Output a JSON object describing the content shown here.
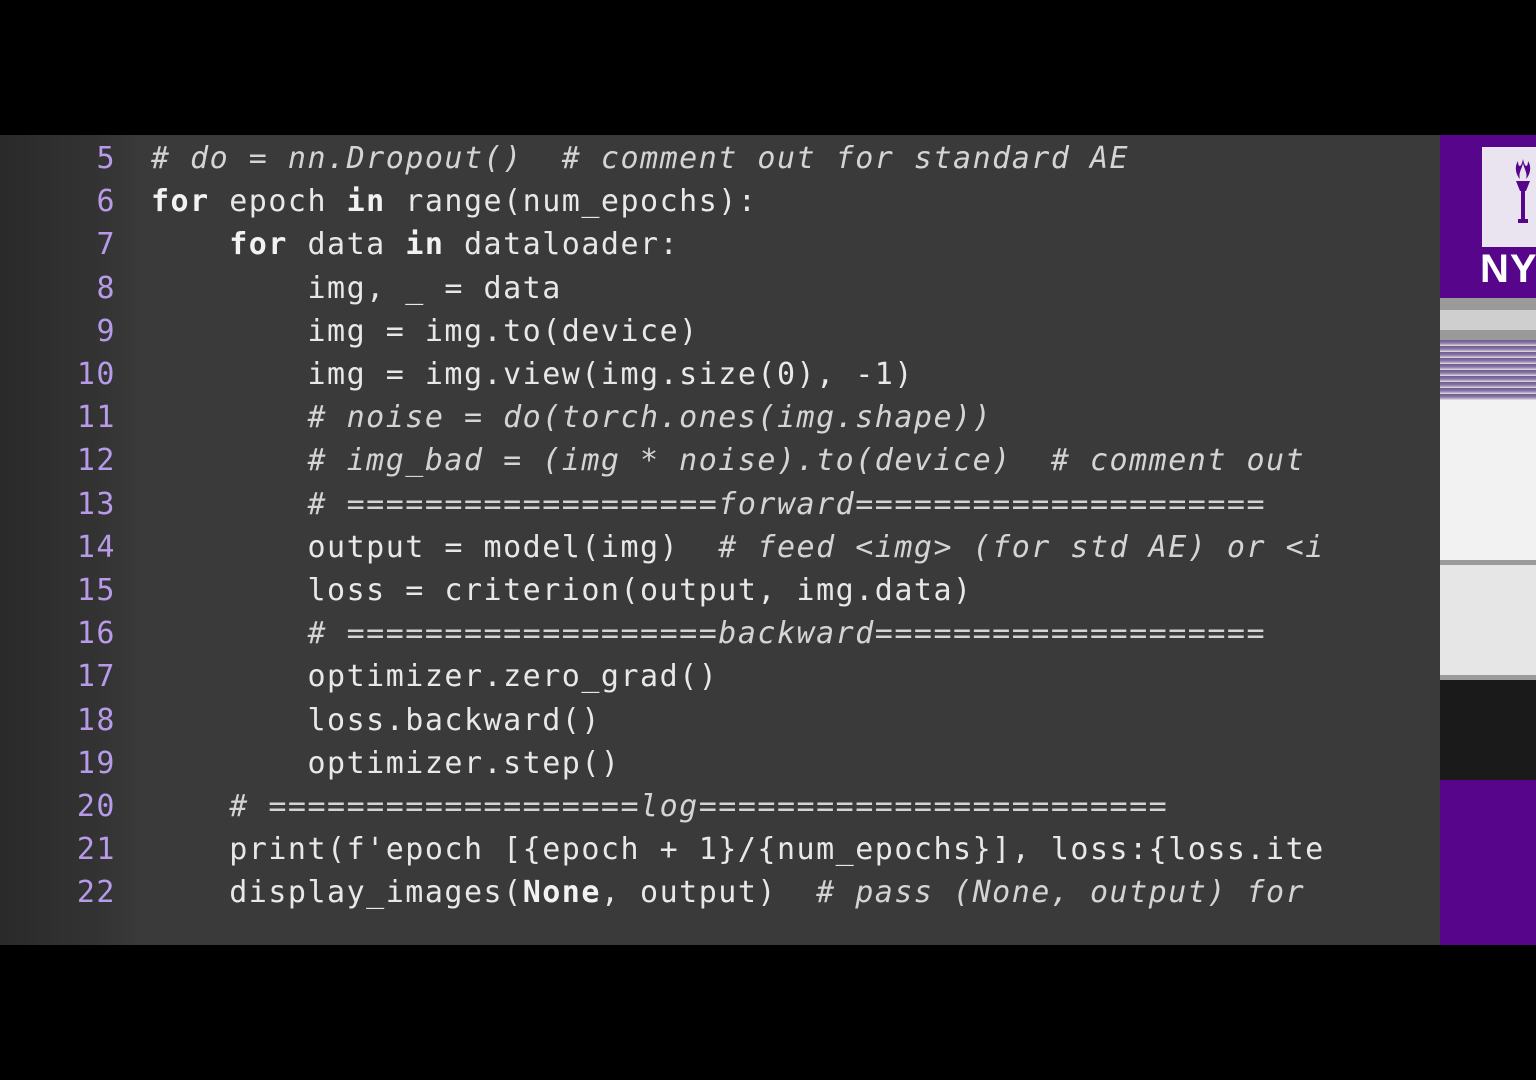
{
  "editor": {
    "lines": [
      {
        "num": "5",
        "indent": "",
        "parts": [
          {
            "t": "cm",
            "v": "# do = nn.Dropout()  # comment out for standard AE"
          }
        ]
      },
      {
        "num": "6",
        "indent": "",
        "parts": [
          {
            "t": "kw",
            "v": "for"
          },
          {
            "t": "tx",
            "v": " epoch "
          },
          {
            "t": "kw",
            "v": "in"
          },
          {
            "t": "tx",
            "v": " range(num_epochs):"
          }
        ]
      },
      {
        "num": "7",
        "indent": "    ",
        "parts": [
          {
            "t": "kw",
            "v": "for"
          },
          {
            "t": "tx",
            "v": " data "
          },
          {
            "t": "kw",
            "v": "in"
          },
          {
            "t": "tx",
            "v": " dataloader:"
          }
        ]
      },
      {
        "num": "8",
        "indent": "        ",
        "parts": [
          {
            "t": "tx",
            "v": "img, _ = data"
          }
        ]
      },
      {
        "num": "9",
        "indent": "        ",
        "parts": [
          {
            "t": "tx",
            "v": "img = img.to(device)"
          }
        ]
      },
      {
        "num": "10",
        "indent": "        ",
        "parts": [
          {
            "t": "tx",
            "v": "img = img.view(img.size(0), -1)"
          }
        ]
      },
      {
        "num": "11",
        "indent": "        ",
        "parts": [
          {
            "t": "cm",
            "v": "# noise = do(torch.ones(img.shape))"
          }
        ]
      },
      {
        "num": "12",
        "indent": "        ",
        "parts": [
          {
            "t": "cm",
            "v": "# img_bad = (img * noise).to(device)  # comment out"
          }
        ]
      },
      {
        "num": "13",
        "indent": "        ",
        "parts": [
          {
            "t": "cm",
            "v": "# ===================forward====================="
          }
        ]
      },
      {
        "num": "14",
        "indent": "        ",
        "parts": [
          {
            "t": "tx",
            "v": "output = model(img)  "
          },
          {
            "t": "cm",
            "v": "# feed <img> (for std AE) or <i"
          }
        ]
      },
      {
        "num": "15",
        "indent": "        ",
        "parts": [
          {
            "t": "tx",
            "v": "loss = criterion(output, img.data)"
          }
        ]
      },
      {
        "num": "16",
        "indent": "        ",
        "parts": [
          {
            "t": "cm",
            "v": "# ===================backward===================="
          }
        ]
      },
      {
        "num": "17",
        "indent": "        ",
        "parts": [
          {
            "t": "tx",
            "v": "optimizer.zero_grad()"
          }
        ]
      },
      {
        "num": "18",
        "indent": "        ",
        "parts": [
          {
            "t": "tx",
            "v": "loss.backward()"
          }
        ]
      },
      {
        "num": "19",
        "indent": "        ",
        "parts": [
          {
            "t": "tx",
            "v": "optimizer.step()"
          }
        ]
      },
      {
        "num": "20",
        "indent": "    ",
        "parts": [
          {
            "t": "cm",
            "v": "# ===================log========================"
          }
        ]
      },
      {
        "num": "21",
        "indent": "    ",
        "parts": [
          {
            "t": "tx",
            "v": "print(f'epoch [{epoch + 1}/{num_epochs}], loss:{loss.ite"
          }
        ]
      },
      {
        "num": "22",
        "indent": "    ",
        "parts": [
          {
            "t": "tx",
            "v": "display_images("
          },
          {
            "t": "kw",
            "v": "None"
          },
          {
            "t": "tx",
            "v": ", output)  "
          },
          {
            "t": "cm",
            "v": "# pass (None, output) for"
          }
        ]
      }
    ]
  },
  "side_logo": {
    "text": "NY"
  },
  "colors": {
    "background": "#000000",
    "editor_bg": "#3a3a3a",
    "line_number": "#b79be8",
    "brand_purple": "#57068c"
  }
}
